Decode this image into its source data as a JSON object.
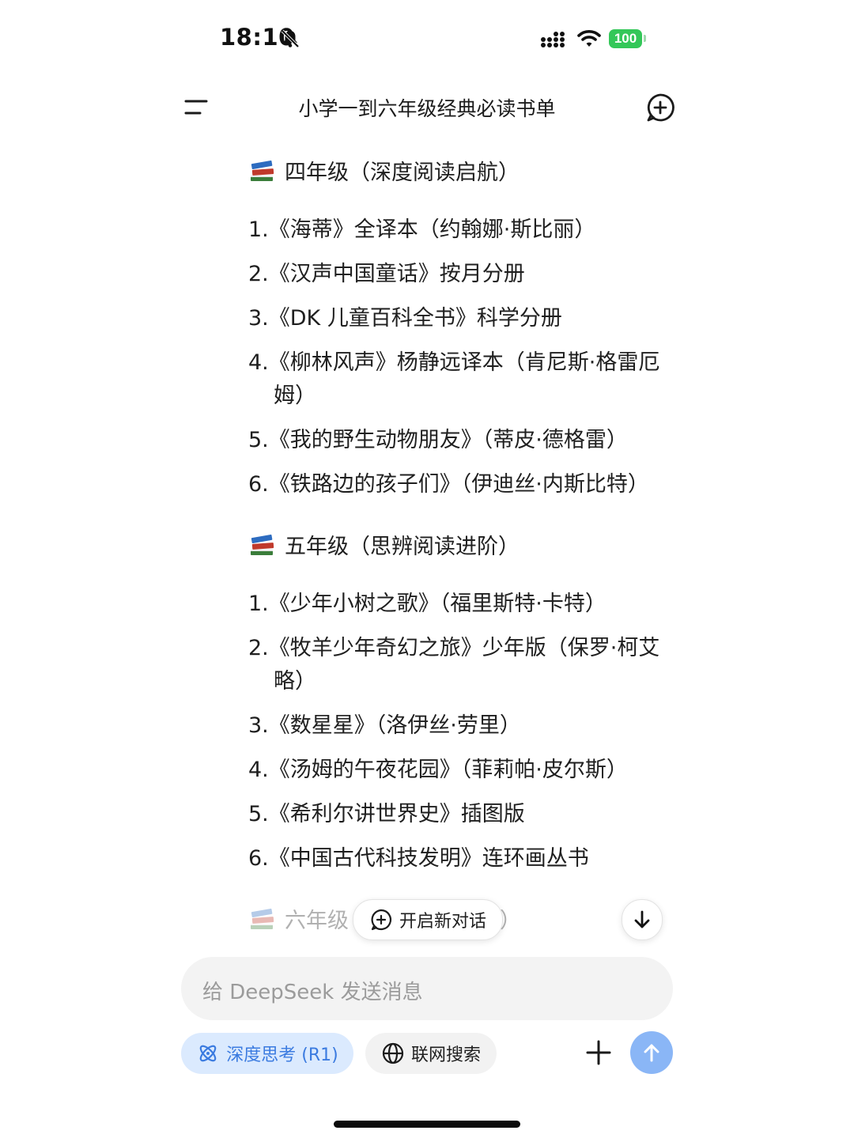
{
  "status_bar": {
    "time": "18:10",
    "battery": "100",
    "icons": [
      "bell-slash-icon",
      "signal-icon",
      "wifi-icon",
      "battery-icon"
    ]
  },
  "header": {
    "title": "小学一到六年级经典必读书单",
    "left_icon": "menu-icon",
    "right_icon": "new-chat-icon"
  },
  "sections": [
    {
      "heading": "四年级（深度阅读启航）",
      "icon": "books-icon",
      "items": [
        "1.《海蒂》全译本（约翰娜·斯比丽）",
        "2.《汉声中国童话》按月分册",
        "3.《DK 儿童百科全书》科学分册",
        "4.《柳林风声》杨静远译本（肯尼斯·格雷厄姆）",
        "5.《我的野生动物朋友》（蒂皮·德格雷）",
        "6.《铁路边的孩子们》（伊迪丝·内斯比特）"
      ]
    },
    {
      "heading": "五年级（思辨阅读进阶）",
      "icon": "books-icon",
      "items": [
        "1.《少年小树之歌》（福里斯特·卡特）",
        "2.《牧羊少年奇幻之旅》少年版（保罗·柯艾略）",
        "3.《数星星》（洛伊丝·劳里）",
        "4.《汤姆的午夜花园》（菲莉帕·皮尔斯）",
        "5.《希利尔讲世界史》插图版",
        "6.《中国古代科技发明》连环画丛书"
      ]
    },
    {
      "heading_visible": "六年级",
      "heading_tail": "）",
      "icon": "books-icon"
    }
  ],
  "floating": {
    "new_chat_label": "开启新对话",
    "scroll_down_icon": "arrow-down-icon"
  },
  "input": {
    "placeholder": "给 DeepSeek 发送消息"
  },
  "toolbar": {
    "deep_think_label": "深度思考 (R1)",
    "web_search_label": "联网搜索",
    "accent_color": "#3b7be0",
    "send_color": "#8ab6f6"
  }
}
